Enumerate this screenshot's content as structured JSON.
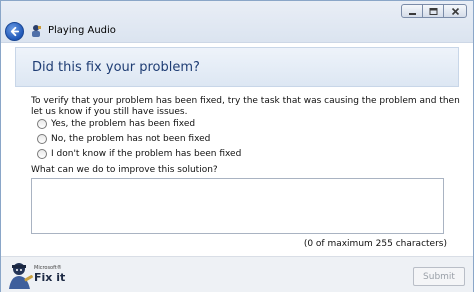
{
  "window": {
    "title": "Playing Audio",
    "caption_buttons": [
      "minimize",
      "maximize",
      "close"
    ]
  },
  "heading": "Did this fix your problem?",
  "instructions": "To verify that your problem has been fixed, try the task that was causing the problem and then let us know if you still have issues.",
  "options": [
    {
      "label": "Yes, the problem has been fixed",
      "selected": false
    },
    {
      "label": "No, the problem has not been fixed",
      "selected": false
    },
    {
      "label": "I don't know if the problem has been fixed",
      "selected": false
    }
  ],
  "improve": {
    "label": "What can we do to improve this solution?",
    "value": "",
    "counter": "(0 of maximum 255 characters)"
  },
  "footer": {
    "brand_small": "Microsoft®",
    "brand": "Fix it",
    "submit_label": "Submit",
    "submit_enabled": false
  },
  "colors": {
    "heading_text": "#1f3d74",
    "back_button": "#1f58b8",
    "border": "#8aa6c8"
  }
}
